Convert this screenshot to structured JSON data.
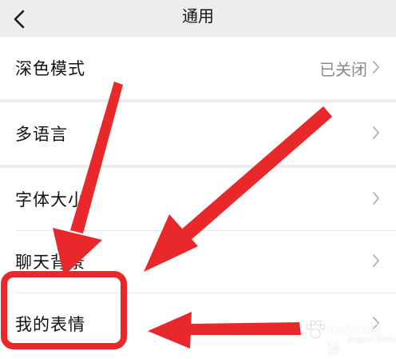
{
  "navbar": {
    "title": "通用"
  },
  "groups": [
    {
      "rows": [
        {
          "label": "深色模式",
          "value": "已关闭"
        }
      ]
    },
    {
      "rows": [
        {
          "label": "多语言"
        }
      ]
    },
    {
      "rows": [
        {
          "label": "字体大小"
        },
        {
          "label": "聊天背景"
        },
        {
          "label": "我的表情"
        }
      ]
    }
  ],
  "annotation": {
    "arrow_color": "#e8282a",
    "highlight_color": "#e8282a"
  },
  "watermark": {
    "text": "Baidu经验",
    "sub": "jingyan.baidu.com"
  }
}
